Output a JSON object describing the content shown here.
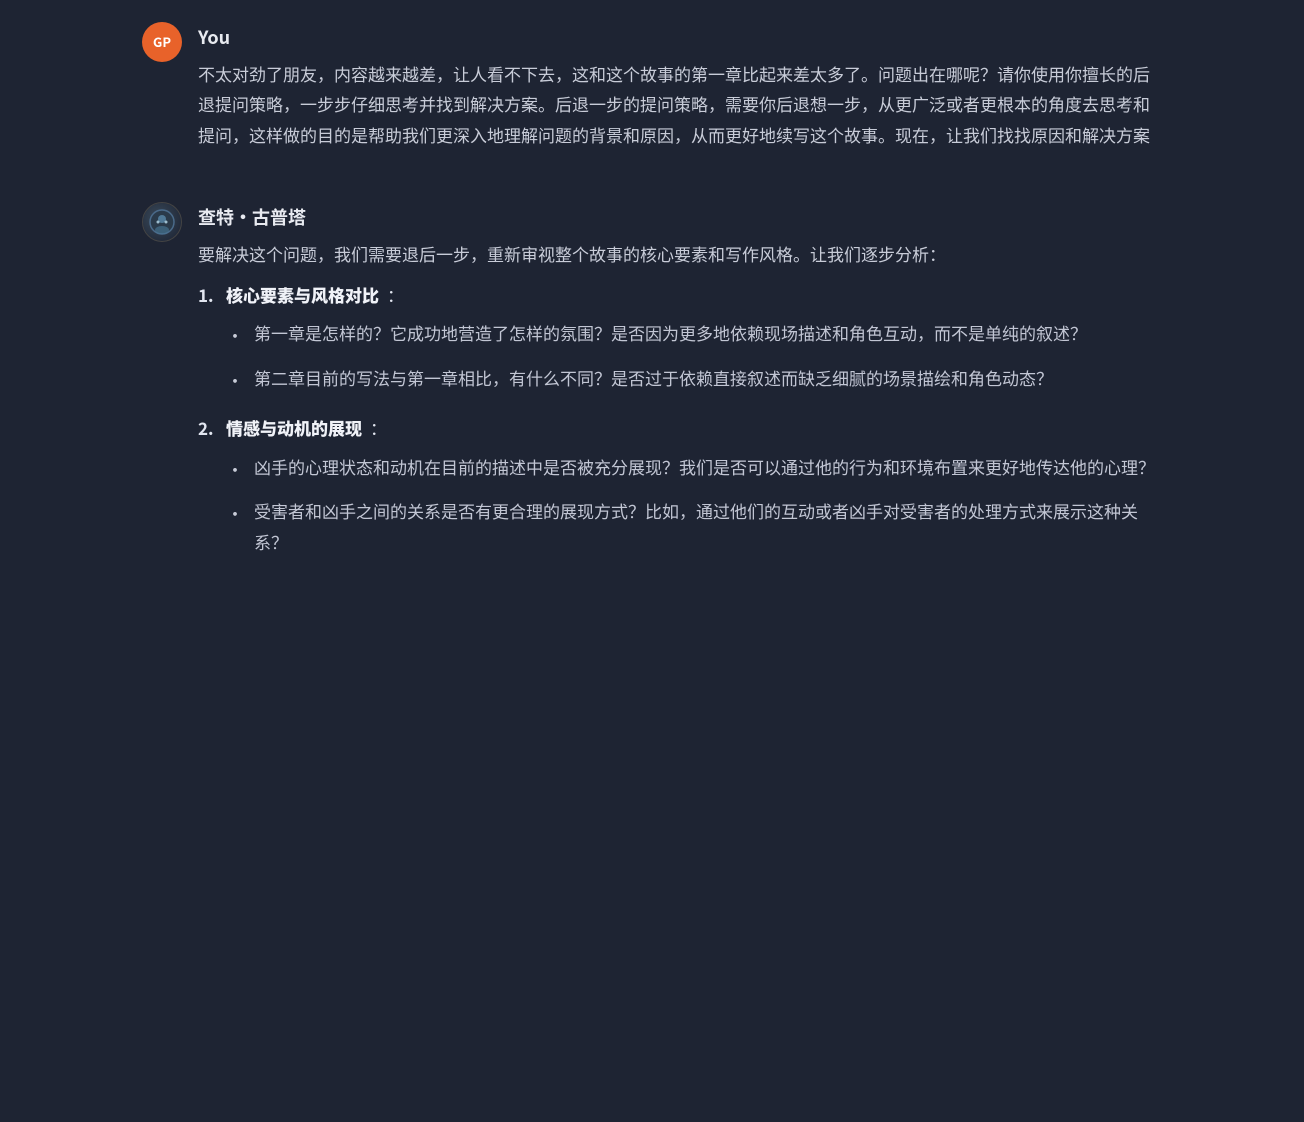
{
  "colors": {
    "background": "#1e2433",
    "text_primary": "#c8ccd8",
    "text_heading": "#e8eaf0",
    "text_bold": "#f0f2f8",
    "avatar_user_bg": "#e8622a",
    "avatar_user_text": "GP"
  },
  "messages": [
    {
      "id": "user-msg",
      "sender": "You",
      "sender_type": "user",
      "avatar_label": "GP",
      "text": "不太对劲了朋友，内容越来越差，让人看不下去，这和这个故事的第一章比起来差太多了。问题出在哪呢？请你使用你擅长的后退提问策略，一步步仔细思考并找到解决方案。后退一步的提问策略，需要你后退想一步，从更广泛或者更根本的角度去思考和提问，这样做的目的是帮助我们更深入地理解问题的背景和原因，从而更好地续写这个故事。现在，让我们找找原因和解决方案"
    },
    {
      "id": "ai-msg",
      "sender": "查特·古普塔",
      "sender_type": "ai",
      "intro": "要解决这个问题，我们需要退后一步，重新审视整个故事的核心要素和写作风格。让我们逐步分析：",
      "sections": [
        {
          "num": "1.",
          "title": "核心要素与风格对比",
          "bullets": [
            "第一章是怎样的？它成功地营造了怎样的氛围？是否因为更多地依赖现场描述和角色互动，而不是单纯的叙述？",
            "第二章目前的写法与第一章相比，有什么不同？是否过于依赖直接叙述而缺乏细腻的场景描绘和角色动态？"
          ]
        },
        {
          "num": "2.",
          "title": "情感与动机的展现",
          "bullets": [
            "凶手的心理状态和动机在目前的描述中是否被充分展现？我们是否可以通过他的行为和环境布置来更好地传达他的心理？",
            "受害者和凶手之间的关系是否有更合理的展现方式？比如，通过他们的互动或者凶手对受害者的处理方式来展示这种关系？"
          ]
        }
      ]
    }
  ]
}
